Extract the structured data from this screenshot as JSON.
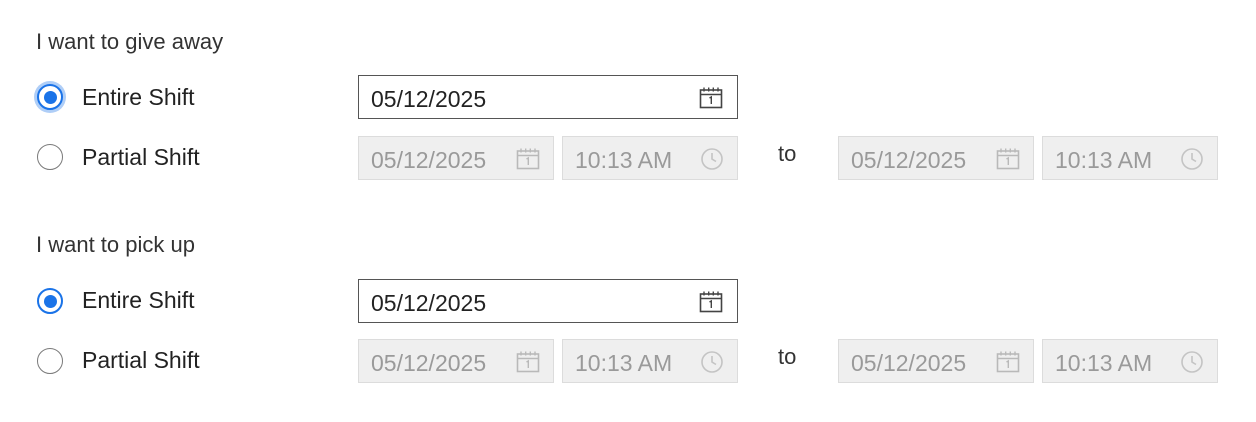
{
  "give_away": {
    "heading": "I want to give away",
    "entire": {
      "label": "Entire Shift",
      "selected": true,
      "date": "05/12/2025"
    },
    "partial": {
      "label": "Partial Shift",
      "selected": false,
      "start_date": "05/12/2025",
      "start_time": "10:13 AM",
      "separator": "to",
      "end_date": "05/12/2025",
      "end_time": "10:13 AM"
    }
  },
  "pick_up": {
    "heading": "I want to pick up",
    "entire": {
      "label": "Entire Shift",
      "selected": true,
      "date": "05/12/2025"
    },
    "partial": {
      "label": "Partial Shift",
      "selected": false,
      "start_date": "05/12/2025",
      "start_time": "10:13 AM",
      "separator": "to",
      "end_date": "05/12/2025",
      "end_time": "10:13 AM"
    }
  },
  "icons": {
    "date": "calendar-icon",
    "time": "clock-icon"
  },
  "colors": {
    "accent": "#1a73e8",
    "disabled_bg": "#efefef",
    "disabled_text": "#9a9a9a"
  }
}
